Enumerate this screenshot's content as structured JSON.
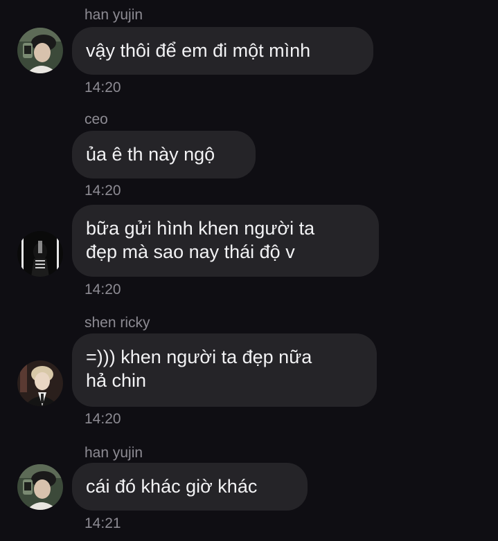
{
  "messages": [
    {
      "sender": "han yujin",
      "avatar_icon": "user-avatar-han-yujin-icon",
      "lines": [
        "vậy thôi để em đi một mình"
      ],
      "time": "14:20"
    },
    {
      "sender": "ceo",
      "avatar_icon": null,
      "lines": [
        "ủa ê th này ngộ"
      ],
      "time": "14:20"
    },
    {
      "sender": "",
      "avatar_icon": "user-avatar-ceo-icon",
      "lines": [
        "bữa gửi hình khen người ta",
        "đẹp mà sao nay thái độ v"
      ],
      "time": "14:20"
    },
    {
      "sender": "shen ricky",
      "avatar_icon": "user-avatar-shen-ricky-icon",
      "lines": [
        "=))) khen người ta đẹp nữa",
        "hả chin"
      ],
      "time": "14:20"
    },
    {
      "sender": "han yujin",
      "avatar_icon": "user-avatar-han-yujin-icon",
      "lines": [
        "cái đó khác giờ khác"
      ],
      "time": "14:21"
    }
  ],
  "colors": {
    "background": "#0f0e13",
    "bubble": "#252428",
    "text": "#f2f2f4",
    "meta": "#8d8b93"
  }
}
